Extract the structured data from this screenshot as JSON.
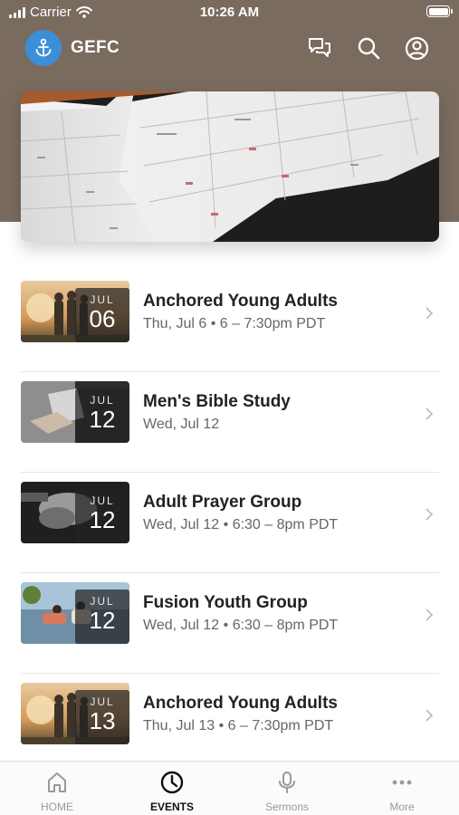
{
  "status_bar": {
    "carrier": "Carrier",
    "time": "10:26 AM"
  },
  "header": {
    "title": "GEFC"
  },
  "events": [
    {
      "month": "JUL",
      "day": "06",
      "title": "Anchored Young Adults",
      "subtitle": "Thu, Jul 6 • 6 – 7:30pm PDT"
    },
    {
      "month": "JUL",
      "day": "12",
      "title": "Men's Bible Study",
      "subtitle": "Wed, Jul 12"
    },
    {
      "month": "JUL",
      "day": "12",
      "title": "Adult Prayer Group",
      "subtitle": "Wed, Jul 12 • 6:30 – 8pm PDT"
    },
    {
      "month": "JUL",
      "day": "12",
      "title": "Fusion Youth Group",
      "subtitle": "Wed, Jul 12 • 6:30 – 8pm PDT"
    },
    {
      "month": "JUL",
      "day": "13",
      "title": "Anchored Young Adults",
      "subtitle": "Thu, Jul 13 • 6 – 7:30pm PDT"
    }
  ],
  "tabs": [
    {
      "label": "HOME",
      "icon": "home-icon",
      "active": false
    },
    {
      "label": "EVENTS",
      "icon": "clock-icon",
      "active": true
    },
    {
      "label": "Sermons",
      "icon": "microphone-icon",
      "active": false
    },
    {
      "label": "More",
      "icon": "more-icon",
      "active": false
    }
  ],
  "colors": {
    "header_bg": "#7a6b5f",
    "logo_blue": "#3b8fd8",
    "active_tab": "#111111",
    "inactive_tab": "#999999"
  }
}
